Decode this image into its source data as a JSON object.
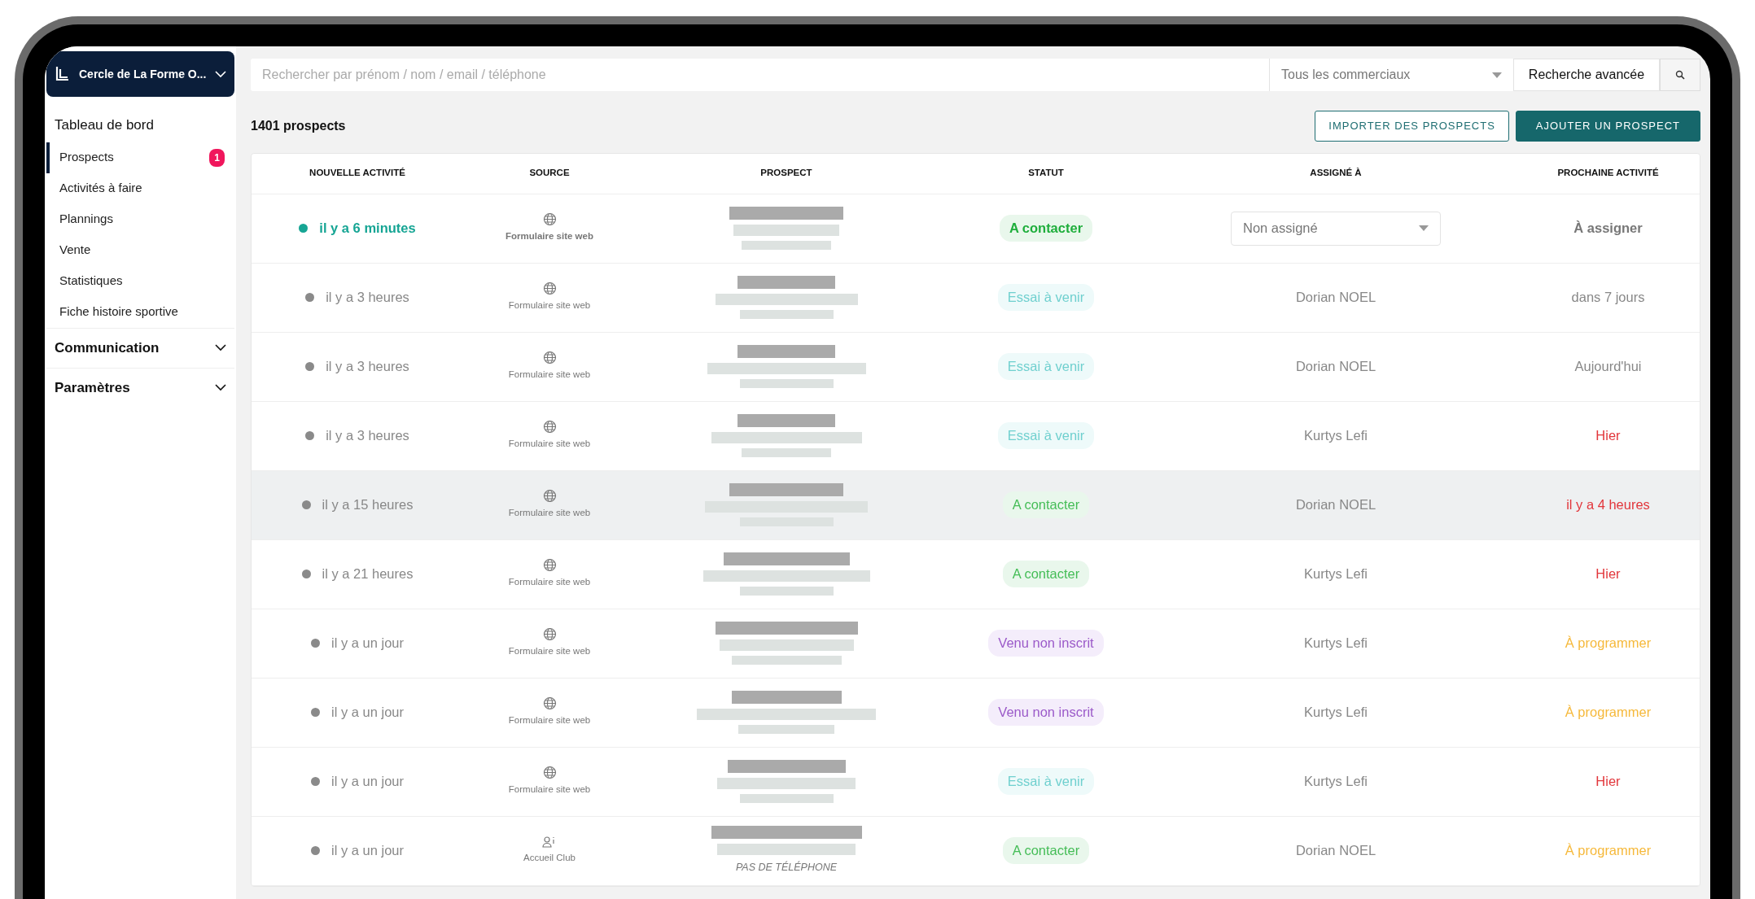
{
  "sidebar": {
    "brand": "Cercle de La Forme O...",
    "nav_title": "Tableau de bord",
    "items": [
      {
        "label": "Prospects",
        "selected": true,
        "badge": "1"
      },
      {
        "label": "Activités à faire",
        "selected": false
      },
      {
        "label": "Plannings",
        "selected": false
      },
      {
        "label": "Vente",
        "selected": false
      },
      {
        "label": "Statistiques",
        "selected": false
      },
      {
        "label": "Fiche histoire sportive",
        "selected": false
      }
    ],
    "sections": [
      {
        "label": "Communication",
        "expanded": false
      },
      {
        "label": "Paramètres",
        "expanded": false
      }
    ]
  },
  "search": {
    "placeholder": "Rechercher par prénom / nom / email / téléphone",
    "salesperson": "Tous les commerciaux",
    "advanced": "Recherche avancée"
  },
  "count": "1401 prospects",
  "buttons": {
    "import": "IMPORTER DES PROSPECTS",
    "add": "AJOUTER UN PROSPECT"
  },
  "table": {
    "columns": [
      "NOUVELLE ACTIVITÉ",
      "SOURCE",
      "PROSPECT",
      "STATUT",
      "ASSIGNÉ À",
      "PROCHAINE ACTIVITÉ"
    ],
    "rows": [
      {
        "unread": true,
        "selected": false,
        "activity": "il y a 6 minutes",
        "source": {
          "kind": "web",
          "label": "Formulaire site web"
        },
        "status": {
          "kind": "contact",
          "label": "A contacter"
        },
        "assigned": {
          "kind": "select",
          "label": "Non assigné"
        },
        "next": {
          "kind": "unassigned",
          "label": "À assigner"
        }
      },
      {
        "unread": false,
        "selected": false,
        "activity": "il y a 3 heures",
        "source": {
          "kind": "web",
          "label": "Formulaire site web"
        },
        "status": {
          "kind": "trial",
          "label": "Essai à venir"
        },
        "assigned": {
          "kind": "text",
          "label": "Dorian NOEL"
        },
        "next": {
          "kind": "neutral",
          "label": "dans 7 jours"
        }
      },
      {
        "unread": false,
        "selected": false,
        "activity": "il y a 3 heures",
        "source": {
          "kind": "web",
          "label": "Formulaire site web"
        },
        "status": {
          "kind": "trial",
          "label": "Essai à venir"
        },
        "assigned": {
          "kind": "text",
          "label": "Dorian NOEL"
        },
        "next": {
          "kind": "neutral",
          "label": "Aujourd'hui"
        }
      },
      {
        "unread": false,
        "selected": false,
        "activity": "il y a 3 heures",
        "source": {
          "kind": "web",
          "label": "Formulaire site web"
        },
        "status": {
          "kind": "trial",
          "label": "Essai à venir"
        },
        "assigned": {
          "kind": "text",
          "label": "Kurtys Lefi"
        },
        "next": {
          "kind": "overdue",
          "label": "Hier"
        }
      },
      {
        "unread": false,
        "selected": true,
        "activity": "il y a 15 heures",
        "source": {
          "kind": "web",
          "label": "Formulaire site web"
        },
        "status": {
          "kind": "contact",
          "label": "A contacter"
        },
        "assigned": {
          "kind": "text",
          "label": "Dorian NOEL"
        },
        "next": {
          "kind": "overdue",
          "label": "il y a 4 heures"
        }
      },
      {
        "unread": false,
        "selected": false,
        "activity": "il y a 21 heures",
        "source": {
          "kind": "web",
          "label": "Formulaire site web"
        },
        "status": {
          "kind": "contact",
          "label": "A contacter"
        },
        "assigned": {
          "kind": "text",
          "label": "Kurtys Lefi"
        },
        "next": {
          "kind": "overdue",
          "label": "Hier"
        }
      },
      {
        "unread": false,
        "selected": false,
        "activity": "il y a un jour",
        "source": {
          "kind": "web",
          "label": "Formulaire site web"
        },
        "status": {
          "kind": "visited",
          "label": "Venu non inscrit"
        },
        "assigned": {
          "kind": "text",
          "label": "Kurtys Lefi"
        },
        "next": {
          "kind": "todo",
          "label": "À programmer"
        }
      },
      {
        "unread": false,
        "selected": false,
        "activity": "il y a un jour",
        "source": {
          "kind": "web",
          "label": "Formulaire site web"
        },
        "status": {
          "kind": "visited",
          "label": "Venu non inscrit"
        },
        "assigned": {
          "kind": "text",
          "label": "Kurtys Lefi"
        },
        "next": {
          "kind": "todo",
          "label": "À programmer"
        }
      },
      {
        "unread": false,
        "selected": false,
        "activity": "il y a un jour",
        "source": {
          "kind": "web",
          "label": "Formulaire site web"
        },
        "status": {
          "kind": "trial",
          "label": "Essai à venir"
        },
        "assigned": {
          "kind": "text",
          "label": "Kurtys Lefi"
        },
        "next": {
          "kind": "overdue",
          "label": "Hier"
        }
      },
      {
        "unread": false,
        "selected": false,
        "activity": "il y a un jour",
        "source": {
          "kind": "club",
          "label": "Accueil Club"
        },
        "prospect_note": "PAS DE TÉLÉPHONE",
        "status": {
          "kind": "contact",
          "label": "A contacter"
        },
        "assigned": {
          "kind": "text",
          "label": "Dorian NOEL"
        },
        "next": {
          "kind": "todo",
          "label": "À programmer"
        }
      }
    ]
  }
}
